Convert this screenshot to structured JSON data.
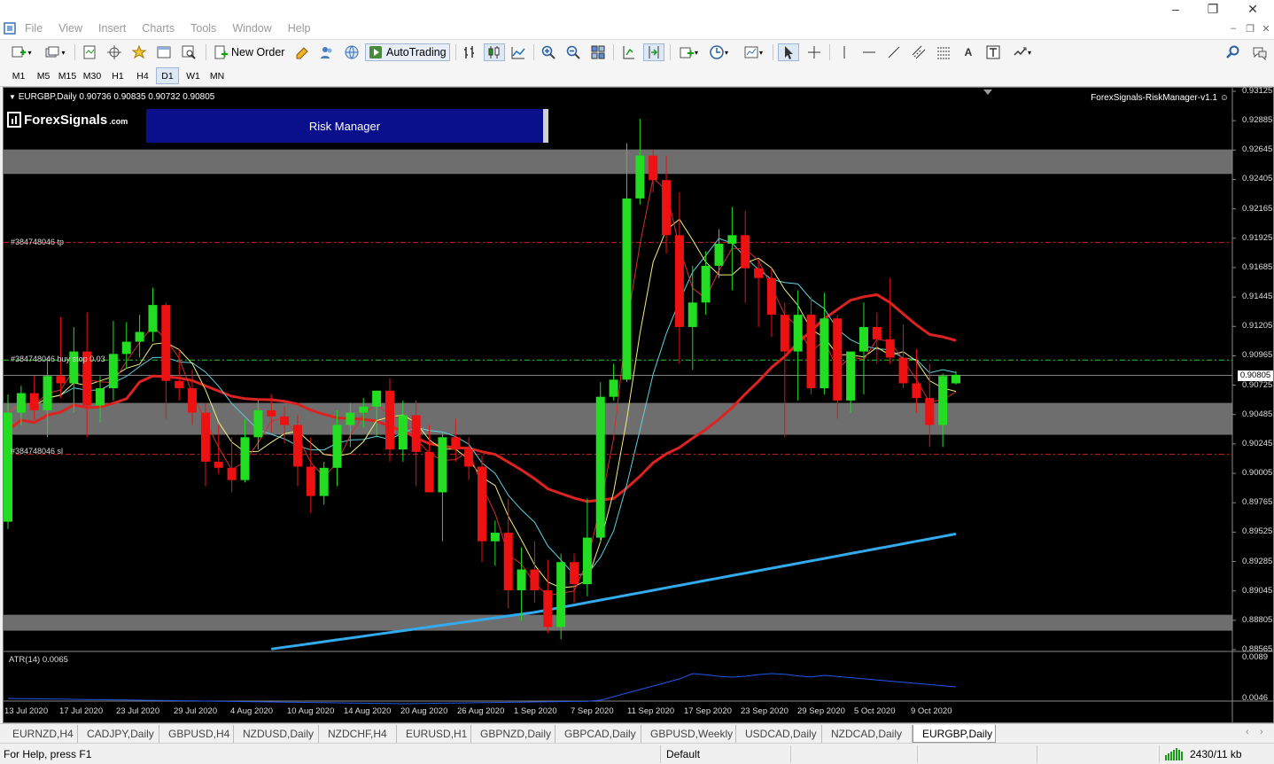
{
  "menu": [
    "File",
    "View",
    "Insert",
    "Charts",
    "Tools",
    "Window",
    "Help"
  ],
  "toolbar": {
    "new_order": "New Order",
    "autotrading": "AutoTrading"
  },
  "timeframes": [
    "M1",
    "M5",
    "M15",
    "M30",
    "H1",
    "H4",
    "D1",
    "W1",
    "MN"
  ],
  "active_timeframe": "D1",
  "chart": {
    "ohlc_header": "EURGBP,Daily  0.90736 0.90835 0.90732 0.90805",
    "indicator_name": "ForexSignals-RiskManager-v1.1",
    "logo_text": "ForexSignals",
    "logo_sub": ".com",
    "risk_manager_label": "Risk Manager",
    "tp_label": "#384748046 tp",
    "buystop_label": "#384748046 buy stop 0.03",
    "sl_label": "#384748046 sl",
    "atr_label": "ATR(14) 0.0065",
    "current_price": "0.90805",
    "price_axis": [
      "0.93125",
      "0.92885",
      "0.92645",
      "0.92405",
      "0.92165",
      "0.91925",
      "0.91685",
      "0.91445",
      "0.91205",
      "0.90965",
      "0.90725",
      "0.90485",
      "0.90245",
      "0.90005",
      "0.89765",
      "0.89525",
      "0.89285",
      "0.89045",
      "0.88805",
      "0.88565"
    ],
    "atr_axis": [
      "0.0089",
      "0.0046"
    ],
    "date_axis": [
      "13 Jul 2020",
      "17 Jul 2020",
      "23 Jul 2020",
      "29 Jul 2020",
      "4 Aug 2020",
      "10 Aug 2020",
      "14 Aug 2020",
      "20 Aug 2020",
      "26 Aug 2020",
      "1 Sep 2020",
      "7 Sep 2020",
      "11 Sep 2020",
      "17 Sep 2020",
      "23 Sep 2020",
      "29 Sep 2020",
      "5 Oct 2020",
      "9 Oct 2020"
    ],
    "colors": {
      "bull": "#22dd22",
      "bear": "#ee1111",
      "zone": "#6e6e6e",
      "ma_slow": "#33aaee",
      "ma_red": "#dd1111"
    }
  },
  "chart_data": {
    "type": "candlestick",
    "symbol": "EURGBP",
    "timeframe": "Daily",
    "ylim": [
      0.88565,
      0.93125
    ],
    "candles_ohlc": [
      [
        0.8961,
        0.9065,
        0.8955,
        0.905
      ],
      [
        0.905,
        0.9072,
        0.904,
        0.9066
      ],
      [
        0.9066,
        0.908,
        0.9044,
        0.9052
      ],
      [
        0.9052,
        0.9095,
        0.903,
        0.908
      ],
      [
        0.908,
        0.9128,
        0.9062,
        0.9074
      ],
      [
        0.9074,
        0.912,
        0.905,
        0.91
      ],
      [
        0.91,
        0.9132,
        0.903,
        0.9056
      ],
      [
        0.9056,
        0.908,
        0.9042,
        0.907
      ],
      [
        0.907,
        0.9125,
        0.906,
        0.9098
      ],
      [
        0.9098,
        0.9124,
        0.9086,
        0.9108
      ],
      [
        0.9108,
        0.913,
        0.9095,
        0.9116
      ],
      [
        0.9116,
        0.9152,
        0.9108,
        0.9138
      ],
      [
        0.9138,
        0.914,
        0.9045,
        0.9076
      ],
      [
        0.9076,
        0.9102,
        0.906,
        0.907
      ],
      [
        0.907,
        0.9085,
        0.904,
        0.905
      ],
      [
        0.905,
        0.9058,
        0.899,
        0.901
      ],
      [
        0.901,
        0.904,
        0.9,
        0.9005
      ],
      [
        0.9005,
        0.903,
        0.8985,
        0.8995
      ],
      [
        0.8995,
        0.9045,
        0.8993,
        0.903
      ],
      [
        0.903,
        0.906,
        0.902,
        0.9052
      ],
      [
        0.9052,
        0.9065,
        0.9034,
        0.9047
      ],
      [
        0.9047,
        0.9055,
        0.9025,
        0.904
      ],
      [
        0.904,
        0.9048,
        0.899,
        0.9006
      ],
      [
        0.9006,
        0.903,
        0.8968,
        0.8982
      ],
      [
        0.8982,
        0.901,
        0.8975,
        0.9005
      ],
      [
        0.9005,
        0.9052,
        0.899,
        0.904
      ],
      [
        0.904,
        0.9058,
        0.9022,
        0.905
      ],
      [
        0.905,
        0.9062,
        0.9038,
        0.9055
      ],
      [
        0.9055,
        0.9068,
        0.903,
        0.9068
      ],
      [
        0.9068,
        0.9078,
        0.901,
        0.902
      ],
      [
        0.902,
        0.906,
        0.901,
        0.9048
      ],
      [
        0.9048,
        0.906,
        0.899,
        0.9018
      ],
      [
        0.9018,
        0.904,
        0.8985,
        0.8985
      ],
      [
        0.8985,
        0.9035,
        0.8945,
        0.903
      ],
      [
        0.903,
        0.9045,
        0.901,
        0.902
      ],
      [
        0.902,
        0.903,
        0.8995,
        0.9006
      ],
      [
        0.9006,
        0.9015,
        0.8928,
        0.8945
      ],
      [
        0.8945,
        0.8962,
        0.8925,
        0.8952
      ],
      [
        0.8952,
        0.898,
        0.889,
        0.8905
      ],
      [
        0.8905,
        0.894,
        0.888,
        0.8922
      ],
      [
        0.8922,
        0.8945,
        0.8895,
        0.8905
      ],
      [
        0.8905,
        0.893,
        0.887,
        0.8875
      ],
      [
        0.8875,
        0.8935,
        0.8865,
        0.8928
      ],
      [
        0.8928,
        0.8935,
        0.8895,
        0.891
      ],
      [
        0.891,
        0.898,
        0.89,
        0.8948
      ],
      [
        0.8948,
        0.9075,
        0.8944,
        0.9063
      ],
      [
        0.9063,
        0.909,
        0.906,
        0.9077
      ],
      [
        0.9077,
        0.927,
        0.9075,
        0.9225
      ],
      [
        0.9225,
        0.929,
        0.922,
        0.926
      ],
      [
        0.926,
        0.9265,
        0.923,
        0.924
      ],
      [
        0.924,
        0.926,
        0.918,
        0.9195
      ],
      [
        0.9195,
        0.923,
        0.909,
        0.912
      ],
      [
        0.912,
        0.917,
        0.9085,
        0.914
      ],
      [
        0.914,
        0.9182,
        0.913,
        0.917
      ],
      [
        0.917,
        0.92,
        0.916,
        0.9188
      ],
      [
        0.9188,
        0.9218,
        0.915,
        0.9195
      ],
      [
        0.9195,
        0.9215,
        0.914,
        0.9168
      ],
      [
        0.9168,
        0.9175,
        0.912,
        0.916
      ],
      [
        0.916,
        0.9168,
        0.9112,
        0.913
      ],
      [
        0.913,
        0.914,
        0.903,
        0.91
      ],
      [
        0.91,
        0.915,
        0.906,
        0.913
      ],
      [
        0.913,
        0.9145,
        0.9065,
        0.907
      ],
      [
        0.907,
        0.9148,
        0.9065,
        0.9127
      ],
      [
        0.9127,
        0.913,
        0.9045,
        0.906
      ],
      [
        0.906,
        0.909,
        0.905,
        0.91
      ],
      [
        0.91,
        0.914,
        0.9065,
        0.912
      ],
      [
        0.912,
        0.9132,
        0.909,
        0.911
      ],
      [
        0.911,
        0.916,
        0.909,
        0.9095
      ],
      [
        0.9095,
        0.9122,
        0.907,
        0.9074
      ],
      [
        0.9074,
        0.9102,
        0.905,
        0.9062
      ],
      [
        0.9062,
        0.909,
        0.9022,
        0.904
      ],
      [
        0.904,
        0.9082,
        0.9022,
        0.908
      ],
      [
        0.9074,
        0.9084,
        0.9073,
        0.9081
      ]
    ],
    "levels": {
      "tp": 0.9189,
      "buy_stop": 0.9093,
      "sl": 0.9016
    },
    "atr14_current": 0.0065
  }
}
